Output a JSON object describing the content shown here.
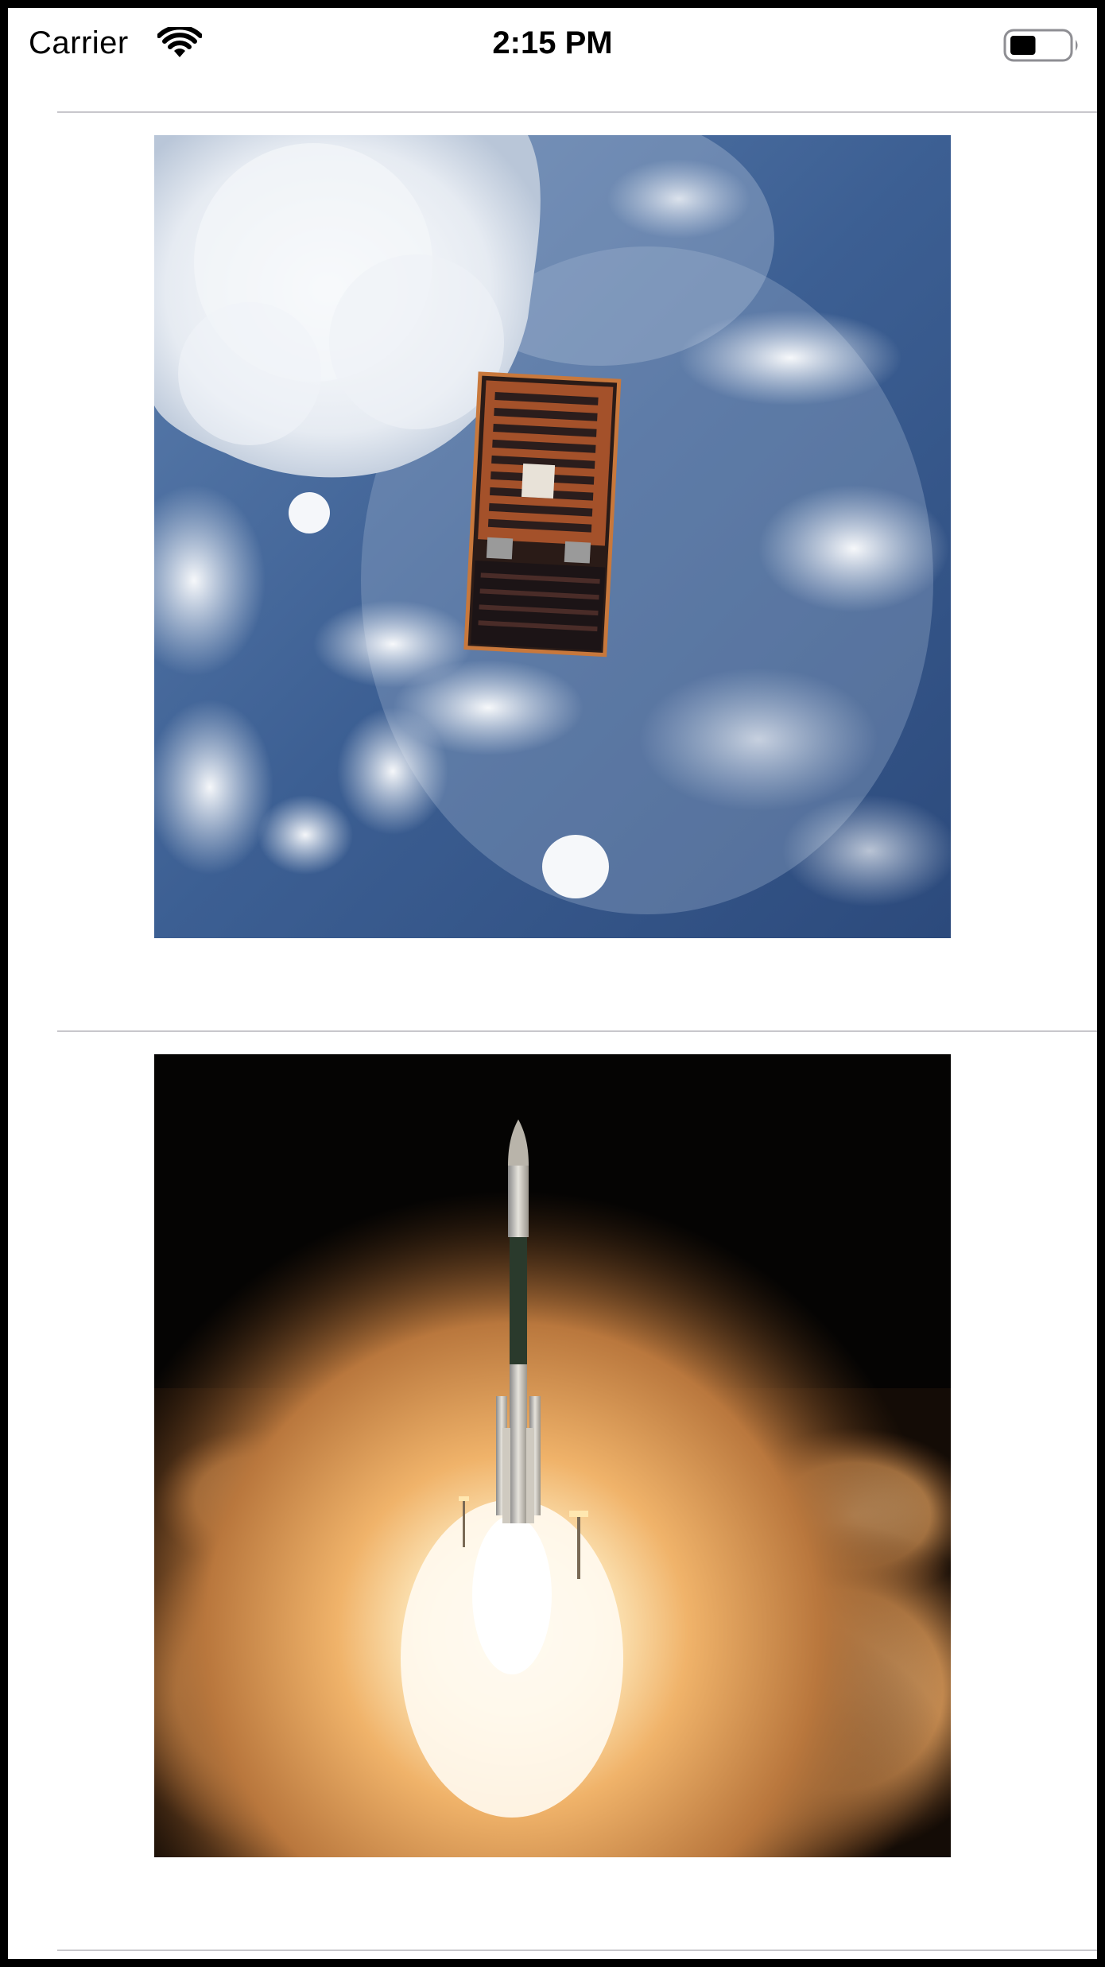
{
  "status_bar": {
    "carrier": "Carrier",
    "time": "2:15 PM",
    "wifi_icon": "wifi-icon",
    "battery_icon": "battery-icon",
    "battery_level_percent": 45
  },
  "colors": {
    "separator": "#c8c7cc",
    "frame": "#000000"
  },
  "cells": [
    {
      "image_icon": "satellite-over-earth-image"
    },
    {
      "image_icon": "rocket-launch-image"
    }
  ]
}
